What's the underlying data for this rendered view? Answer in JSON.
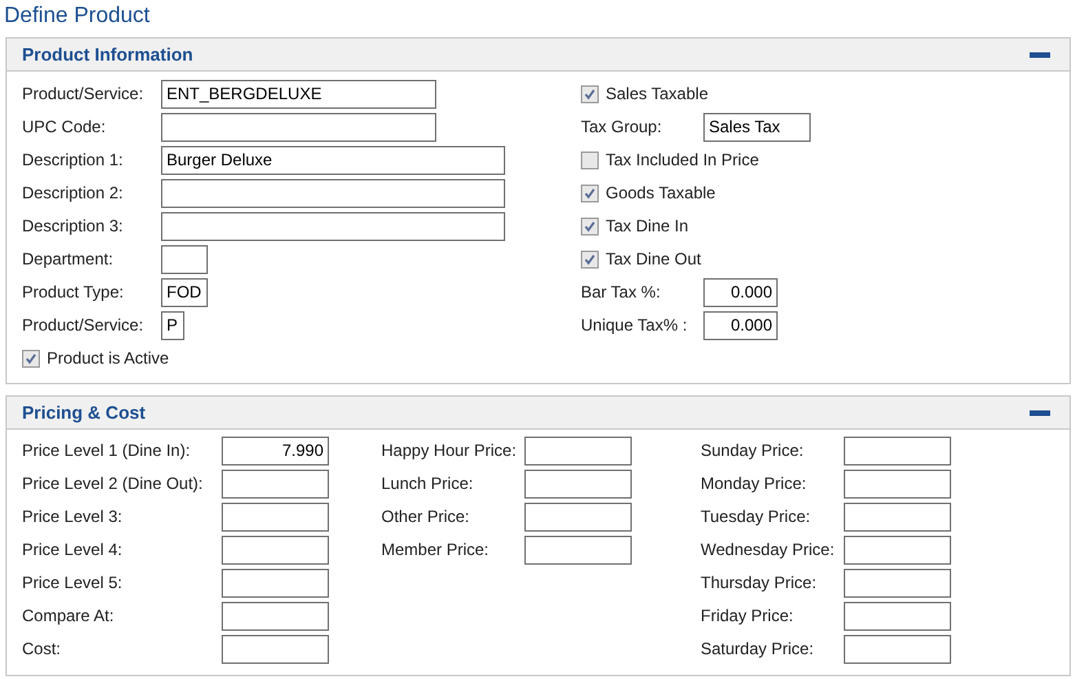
{
  "page_title": "Define Product",
  "product_information": {
    "title": "Product Information",
    "left": [
      {
        "kind": "text",
        "label": "Product/Service:",
        "value": "ENT_BERGDELUXE"
      },
      {
        "kind": "text",
        "label": "UPC Code:"
      },
      {
        "kind": "text",
        "label": "Description 1:",
        "value": "Burger Deluxe"
      },
      {
        "kind": "text",
        "label": "Description 2:"
      },
      {
        "kind": "text",
        "label": "Description 3:"
      },
      {
        "kind": "text",
        "label": "Department:"
      },
      {
        "kind": "text",
        "label": "Product Type:",
        "value": "FOD"
      },
      {
        "kind": "text",
        "label": "Product/Service:",
        "value": "P"
      },
      {
        "kind": "checkbox",
        "label": "Product is Active",
        "checked": true
      }
    ],
    "right": [
      {
        "kind": "checkbox",
        "label": "Sales Taxable",
        "checked": true
      },
      {
        "kind": "text",
        "label": "Tax Group:",
        "value": "Sales Tax"
      },
      {
        "kind": "checkbox",
        "label": "Tax Included In Price",
        "checked": false
      },
      {
        "kind": "checkbox",
        "label": "Goods Taxable",
        "checked": true
      },
      {
        "kind": "checkbox",
        "label": "Tax Dine In",
        "checked": true
      },
      {
        "kind": "checkbox",
        "label": "Tax Dine Out",
        "checked": true
      },
      {
        "kind": "number",
        "label": "Bar Tax %:",
        "value": "0.000"
      },
      {
        "kind": "number",
        "label": "Unique Tax% :",
        "value": "0.000"
      }
    ]
  },
  "pricing_cost": {
    "title": "Pricing & Cost",
    "columns": [
      [
        {
          "label": "Price Level 1 (Dine In):",
          "value": "7.990"
        },
        {
          "label": "Price Level 2 (Dine Out):"
        },
        {
          "label": "Price Level 3:"
        },
        {
          "label": "Price Level 4:"
        },
        {
          "label": "Price Level 5:"
        },
        {
          "label": "Compare At:"
        },
        {
          "label": "Cost:"
        }
      ],
      [
        {
          "label": "Happy Hour Price:"
        },
        {
          "label": "Lunch Price:"
        },
        {
          "label": "Other Price:"
        },
        {
          "label": "Member Price:"
        }
      ],
      [
        {
          "label": "Sunday Price:"
        },
        {
          "label": "Monday Price:"
        },
        {
          "label": "Tuesday Price:"
        },
        {
          "label": "Wednesday Price:"
        },
        {
          "label": "Thursday Price:"
        },
        {
          "label": "Friday Price:"
        },
        {
          "label": "Saturday Price:"
        }
      ]
    ]
  }
}
